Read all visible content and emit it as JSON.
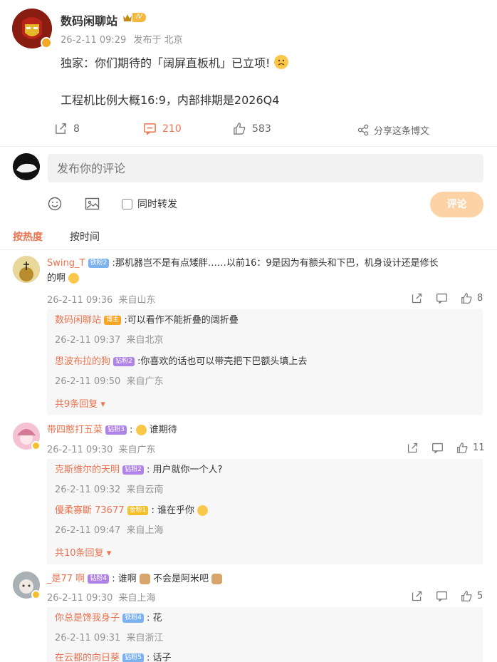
{
  "post": {
    "author": "数码闲聊站",
    "level_badge": "IV",
    "meta_time": "26-2-11 09:29",
    "meta_source": "发布于 北京",
    "line1": "独家：你们期待的「阔屏直板机」已立项!",
    "line2": "工程机比例大概16:9，内部排期是2026Q4",
    "repost_count": "8",
    "comment_count": "210",
    "like_count": "583",
    "share_label": "分享这条博文"
  },
  "composer": {
    "placeholder": "发布你的评论",
    "repost_checkbox_label": "同时转发",
    "submit_label": "评论"
  },
  "sort_tabs": {
    "hot": "按热度",
    "time": "按时间"
  },
  "comments": [
    {
      "user": "Swing_T",
      "badge": "铁粉2",
      "text": ":那机器岂不是有点矮胖……以前16：9是因为有额头和下巴，机身设计还是修长",
      "text2": "的啊",
      "time": "26-2-11 09:36",
      "loc": "来自山东",
      "likes": "8",
      "replies": [
        {
          "user": "数码闲聊站",
          "badge": "博主",
          "text": ":可以看作不能折叠的阔折叠",
          "time": "26-2-11 09:37",
          "loc": "来自北京"
        },
        {
          "user": "思波布拉的狗",
          "badge": "钻粉2",
          "text": ":你喜欢的话也可以带壳把下巴额头填上去",
          "time": "26-2-11 09:50",
          "loc": "来自广东"
        }
      ],
      "more": "共9条回复"
    },
    {
      "user": "带四憨打五菜",
      "badge": "钻粉3",
      "text": ":",
      "text2": "谁期待",
      "time": "26-2-11 09:30",
      "loc": "来自广东",
      "likes": "11",
      "replies": [
        {
          "user": "克斯维尔的天明",
          "badge": "钻粉2",
          "text": ": 用户就你一个人?",
          "time": "26-2-11 09:32",
          "loc": "来自云南"
        },
        {
          "user": "優柔寡斷 73677",
          "badge": "金粉1",
          "text": ": 谁在乎你",
          "time": "26-2-11 09:47",
          "loc": "来自上海"
        }
      ],
      "more": "共10条回复"
    },
    {
      "user": "_是77 啊",
      "badge": "钻粉4",
      "text": ": 谁啊",
      "text2": "不会是阿米吧",
      "time": "26-2-11 09:30",
      "loc": "来自上海",
      "likes": "5",
      "replies": [
        {
          "user": "你总是馋我身子",
          "badge": "铁粉4",
          "text": ": 花",
          "time": "26-2-11 09:31",
          "loc": "来自浙江"
        },
        {
          "user": "在云都的向日葵",
          "badge": "钻粉5",
          "text": ": 话子",
          "time": "",
          "loc": ""
        }
      ]
    }
  ],
  "colors": {
    "accent": "#eb7350",
    "orange_btn": "#fbd3a6",
    "link": "#eb7350"
  }
}
